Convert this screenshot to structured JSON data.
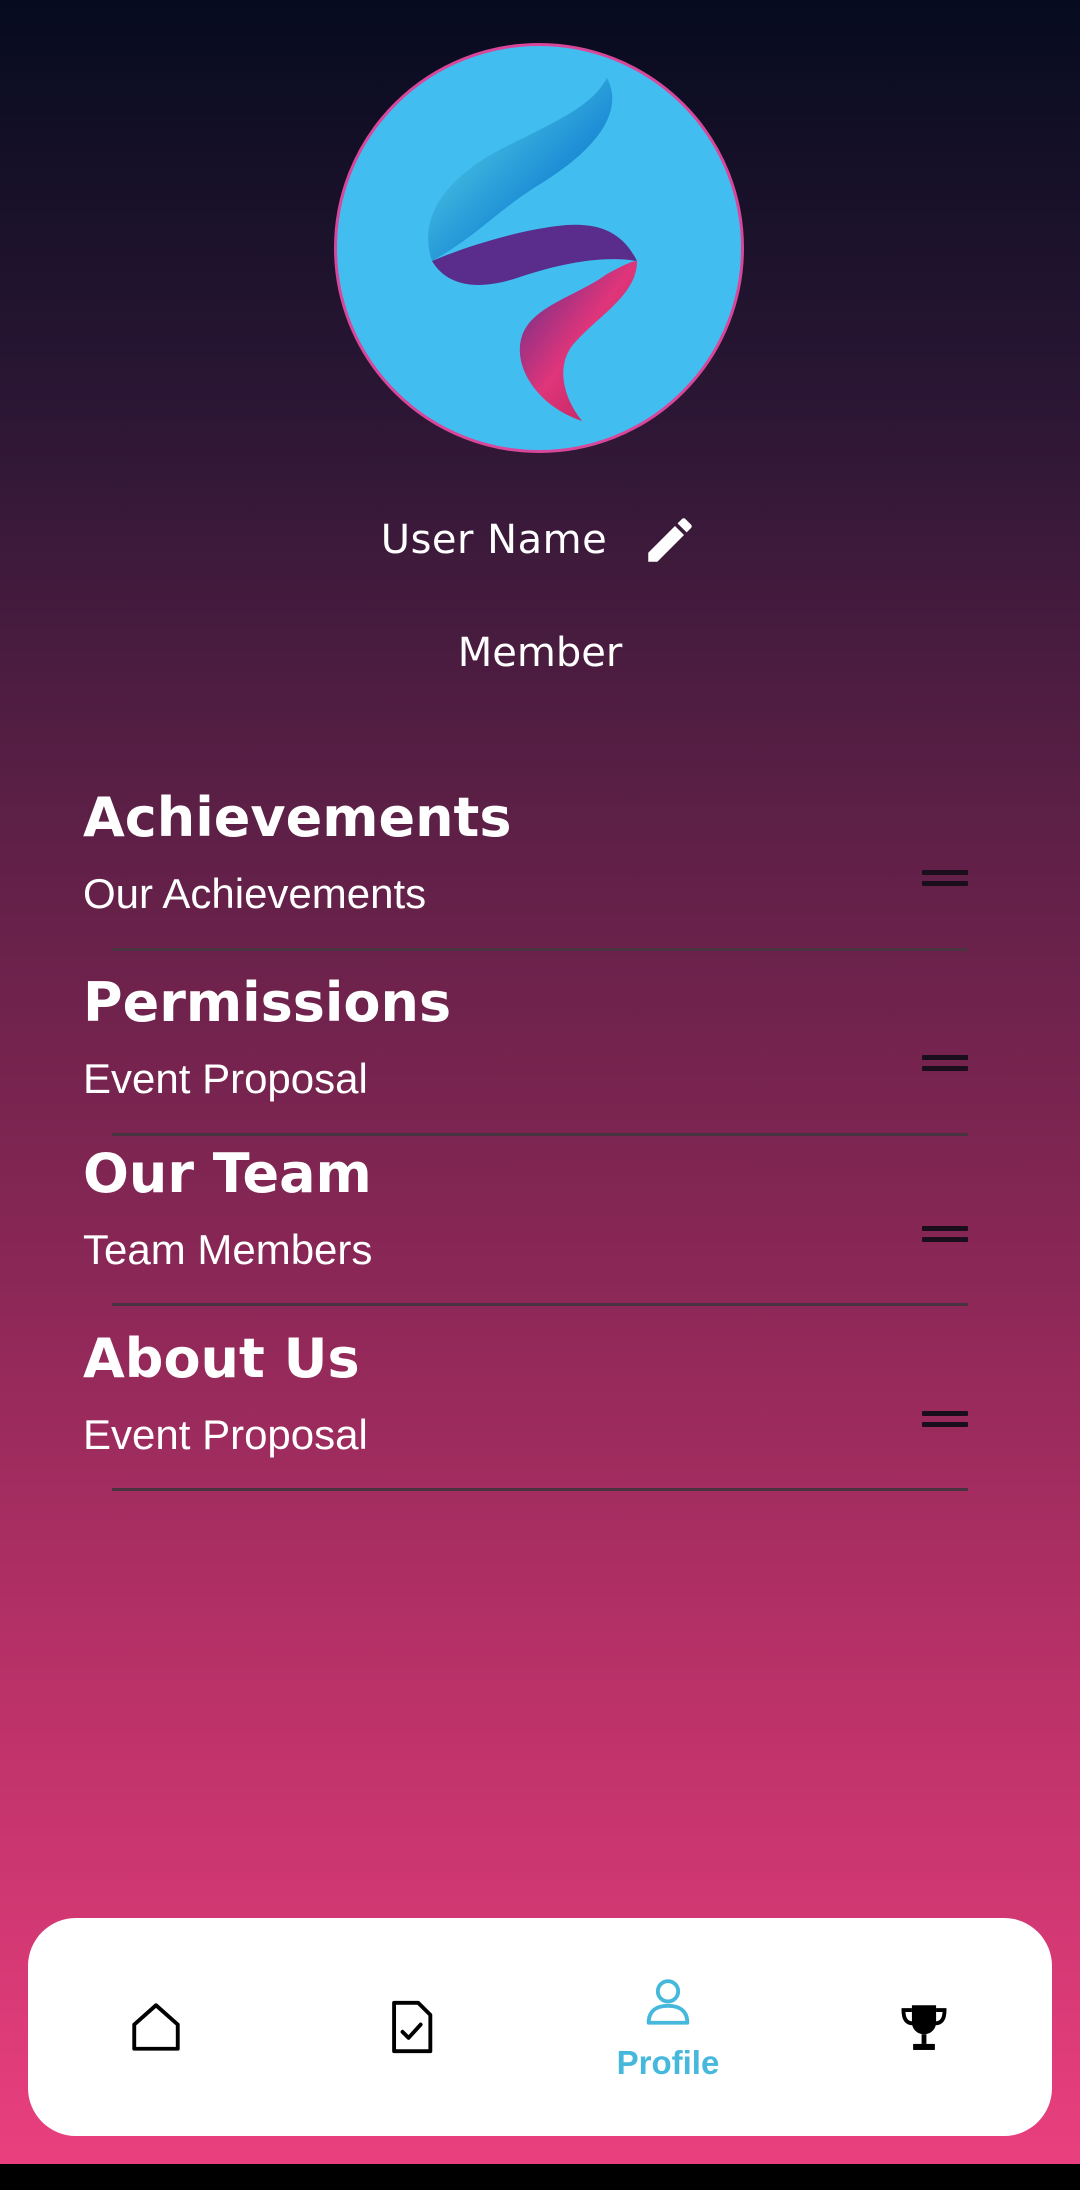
{
  "profile": {
    "user_name": "User Name",
    "role": "Member"
  },
  "sections": [
    {
      "title": "Achievements",
      "subtitle": "Our Achievements"
    },
    {
      "title": "Permissions",
      "subtitle": "Event Proposal"
    },
    {
      "title": "Our Team",
      "subtitle": "Team Members"
    },
    {
      "title": "About Us",
      "subtitle": "Event Proposal"
    }
  ],
  "nav": {
    "items": [
      {
        "icon": "home-icon",
        "label": ""
      },
      {
        "icon": "document-check-icon",
        "label": ""
      },
      {
        "icon": "person-icon",
        "label": "Profile",
        "active": true
      },
      {
        "icon": "trophy-icon",
        "label": ""
      }
    ],
    "active_color": "#45b8dc"
  },
  "colors": {
    "gradient_top": "#060b1f",
    "gradient_bottom": "#ec407f",
    "avatar_bg": "#41bdf0"
  }
}
